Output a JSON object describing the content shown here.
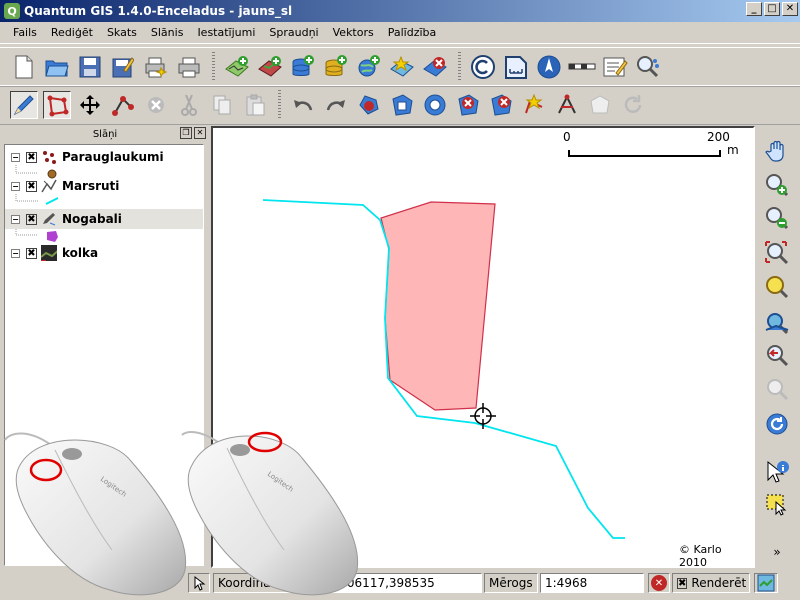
{
  "window": {
    "title": "Quantum GIS 1.4.0-Enceladus - jauns_sl",
    "app_icon": "Q",
    "min_label": "_",
    "max_label": "□",
    "close_label": "✕"
  },
  "menu": [
    "Fails",
    "Rediģēt",
    "Skats",
    "Slānis",
    "Iestatījumi",
    "Spraudņi",
    "Vektors",
    "Palīdzība"
  ],
  "toolbar1": {
    "icons": [
      "new-project-icon",
      "open-project-icon",
      "save-project-icon",
      "save-as-icon",
      "print-composer-icon",
      "print-icon",
      "add-vector-layer-icon",
      "add-raster-layer-icon",
      "add-postgis-layer-icon",
      "add-spatialite-layer-icon",
      "add-wms-layer-icon",
      "new-vector-layer-icon",
      "remove-layer-icon",
      "copyright-label-icon",
      "north-arrow-icon",
      "scale-bar-icon",
      "scalebar-icon",
      "annotation-icon",
      "identify-icon"
    ]
  },
  "toolbar2": {
    "icons": [
      "toggle-editing-icon",
      "capture-polygon-icon",
      "move-feature-icon",
      "node-tool-icon",
      "delete-selected-icon",
      "cut-features-icon",
      "copy-features-icon",
      "paste-features-icon",
      "undo-icon",
      "redo-icon",
      "simplify-feature-icon",
      "add-ring-icon",
      "add-island-icon",
      "delete-ring-icon",
      "delete-part-icon",
      "reshape-features-icon",
      "split-features-icon",
      "merge-features-icon",
      "rotate-point-symbols-icon"
    ]
  },
  "layers_panel": {
    "title": "Slāņi",
    "float_label": "❐",
    "close_label": "✕",
    "layers": [
      {
        "name": "Parauglaukumi",
        "checked": "✖",
        "expander": "−",
        "selected": false,
        "icon": "point-layer-icon"
      },
      {
        "name": "Marsruti",
        "checked": "✖",
        "expander": "−",
        "selected": false,
        "icon": "line-layer-icon"
      },
      {
        "name": "Nogabali",
        "checked": "✖",
        "expander": "−",
        "selected": true,
        "icon": "polygon-layer-icon"
      },
      {
        "name": "kolka",
        "checked": "✖",
        "expander": "−",
        "selected": false,
        "icon": "raster-layer-icon"
      }
    ]
  },
  "map": {
    "scalebar": {
      "start": "0",
      "end": "200",
      "unit": "m"
    },
    "copyright": "© Karlo 2010",
    "line_color": "#00e5ee",
    "polygon_fill": "#ffb6b6",
    "polygon_stroke": "#d0304a"
  },
  "right_toolbar": {
    "icons": [
      "pan-icon",
      "zoom-in-icon",
      "zoom-out-icon",
      "zoom-full-icon",
      "zoom-to-selection-icon",
      "zoom-to-layer-icon",
      "zoom-last-icon",
      "zoom-next-icon",
      "refresh-icon",
      "identify-features-icon",
      "select-features-icon",
      "more-tools-icon"
    ]
  },
  "status": {
    "coord_label": "Koordinātes:",
    "coord_value": "406117,398535",
    "scale_label": "Mērogs",
    "scale_value": "1:4968",
    "stop_label": "✕",
    "render_check": "✖",
    "render_label": "Renderēt"
  },
  "overlay": {
    "mouse_brand": "Logitech",
    "highlight_color": "#e00000"
  }
}
